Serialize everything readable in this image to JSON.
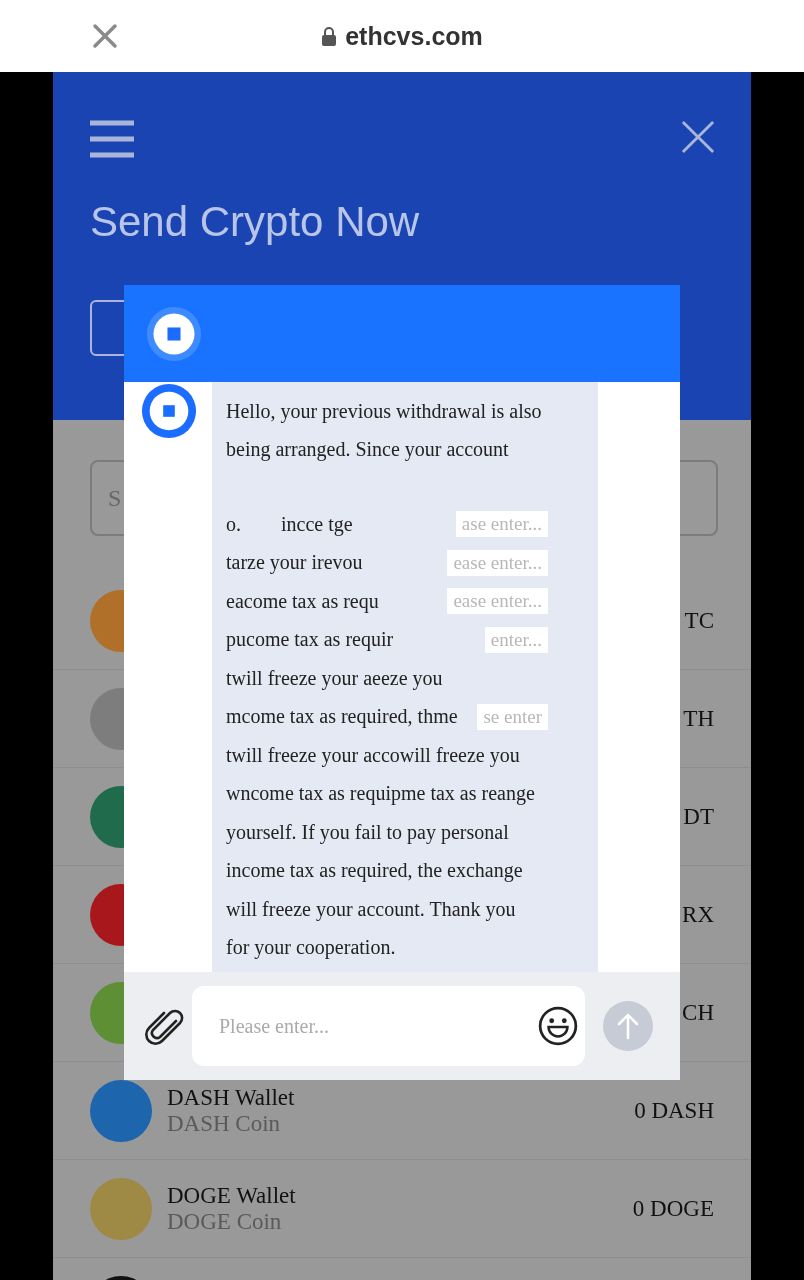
{
  "browser": {
    "url": "ethcvs.com"
  },
  "header": {
    "title": "Send Crypto Now"
  },
  "search": {
    "placeholder": "S"
  },
  "coins": [
    {
      "amount": "TC",
      "color": "#b0702a"
    },
    {
      "amount": "TH",
      "color": "#7d7d7d"
    },
    {
      "amount": "DT",
      "color": "#1f6b4c"
    },
    {
      "amount": "RX",
      "color": "#a8171c"
    },
    {
      "amount": "CH",
      "color": "#5f8f34"
    },
    {
      "name": "DASH Wallet",
      "sub": "DASH Coin",
      "amount": "0 DASH",
      "color": "#1d65ad"
    },
    {
      "name": "DOGE Wallet",
      "sub": "DOGE Coin",
      "amount": "0 DOGE",
      "color": "#9e8a45"
    }
  ],
  "chat": {
    "lines": [
      {
        "text": "Hello, your previous withdrawal is also"
      },
      {
        "text": "being arranged. Since your account"
      },
      {
        "text": "o.        incce tge",
        "ghost": "ase enter..."
      },
      {
        "text": "tarze your irevou",
        "ghost": "ease enter..."
      },
      {
        "text": "eacome tax as requ",
        "ghost": "ease enter..."
      },
      {
        "text": "pucome tax as requir",
        "ghost": "enter..."
      },
      {
        "text": "twill freeze your aeeze you"
      },
      {
        "text": "mcome tax as required, thme",
        "ghost": "se enter"
      },
      {
        "text": "twill freeze your accowill freeze you"
      },
      {
        "text": "wncome tax as requipme tax as reange"
      },
      {
        "text": "yourself. If you fail to pay personal"
      },
      {
        "text": "income tax as required, the exchange"
      },
      {
        "text": "will freeze your account. Thank you"
      },
      {
        "text": "for your cooperation."
      }
    ],
    "input": {
      "placeholder": "Please enter..."
    }
  }
}
